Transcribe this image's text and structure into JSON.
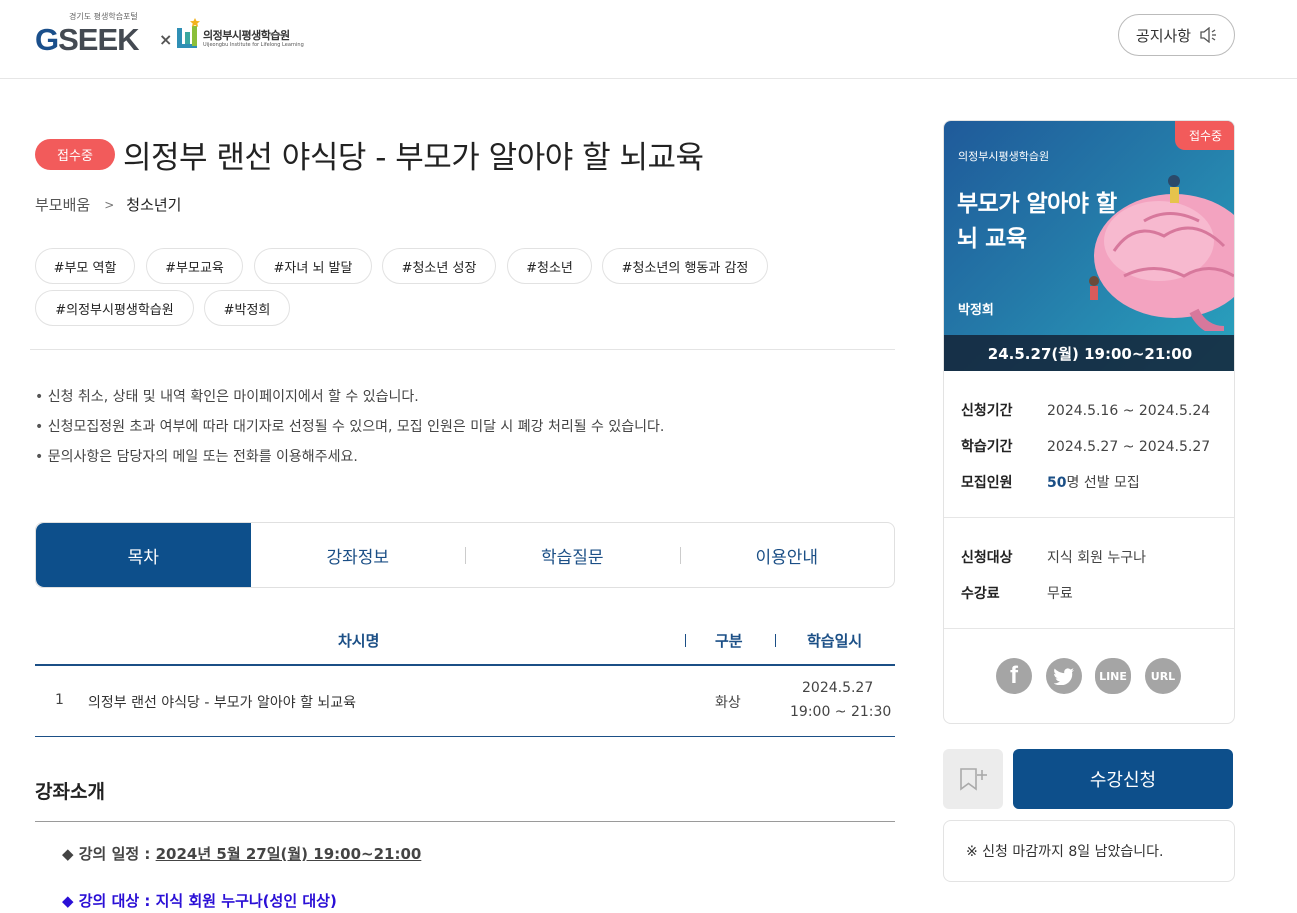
{
  "header": {
    "logo_sub": "경기도 평생학습포털",
    "logo_gseek_g": "G",
    "logo_gseek_rest": "SEEK",
    "logo_x": "×",
    "institute_name": "의정부시평생학습원",
    "institute_name_en": "Uijeongbu Institute for Lifelong Learning",
    "notice_label": "공지사항"
  },
  "course": {
    "status_badge": "접수중",
    "title": "의정부 랜선 야식당 - 부모가 알아야 할 뇌교육",
    "breadcrumb": [
      "부모배움",
      "청소년기"
    ],
    "tags": [
      "#부모 역할",
      "#부모교육",
      "#자녀 뇌 발달",
      "#청소년 성장",
      "#청소년",
      "#청소년의 행동과 감정",
      "#의정부시평생학습원",
      "#박정희"
    ],
    "notes": [
      "신청 취소, 상태 및 내역 확인은 마이페이지에서 할 수 있습니다.",
      "신청모집정원 초과 여부에 따라 대기자로 선정될 수 있으며, 모집 인원은 미달 시 폐강 처리될 수 있습니다.",
      "문의사항은 담당자의 메일 또는 전화를 이용해주세요."
    ]
  },
  "tabs": [
    "목차",
    "강좌정보",
    "학습질문",
    "이용안내"
  ],
  "table": {
    "headers": [
      "차시명",
      "구분",
      "학습일시"
    ],
    "rows": [
      {
        "no": "1",
        "name": "의정부 랜선 야식당 - 부모가 알아야 할 뇌교육",
        "type": "화상",
        "date": "2024.5.27",
        "time": "19:00 ~ 21:30"
      }
    ]
  },
  "intro": {
    "title": "강좌소개",
    "schedule_label": "◆ 강의 일정 : ",
    "schedule_value": "2024년 5월 27일(월) 19:00~21:00",
    "target_label": "◆ 강의 대상 : ",
    "target_value": "지식 회원 누구나(성인 대상)",
    "target_color": "#2a0fd6"
  },
  "card": {
    "poster_badge": "접수중",
    "poster_inst": "의정부시평생학습원",
    "poster_title_1": "부모가 알아야 할",
    "poster_title_2": "뇌 교육",
    "poster_author": "박정희",
    "poster_date": "24.5.27(월) 19:00~21:00",
    "info": {
      "apply_period_label": "신청기간",
      "apply_period": "2024.5.16 ~ 2024.5.24",
      "study_period_label": "학습기간",
      "study_period": "2024.5.27 ~ 2024.5.27",
      "recruit_label": "모집인원",
      "recruit_count": "50",
      "recruit_suffix": "명 선발 모집",
      "target_label": "신청대상",
      "target": "지식 회원 누구나",
      "fee_label": "수강료",
      "fee": "무료"
    },
    "share": {
      "facebook": "f",
      "twitter": "twitter-icon",
      "line": "LINE",
      "url": "URL"
    }
  },
  "actions": {
    "apply_label": "수강신청",
    "deadline_text": "※ 신청 마감까지 8일 남았습니다."
  },
  "colors": {
    "accent": "#0d4f8b",
    "badge": "#f25b5b",
    "link_blue": "#1b4f86"
  }
}
